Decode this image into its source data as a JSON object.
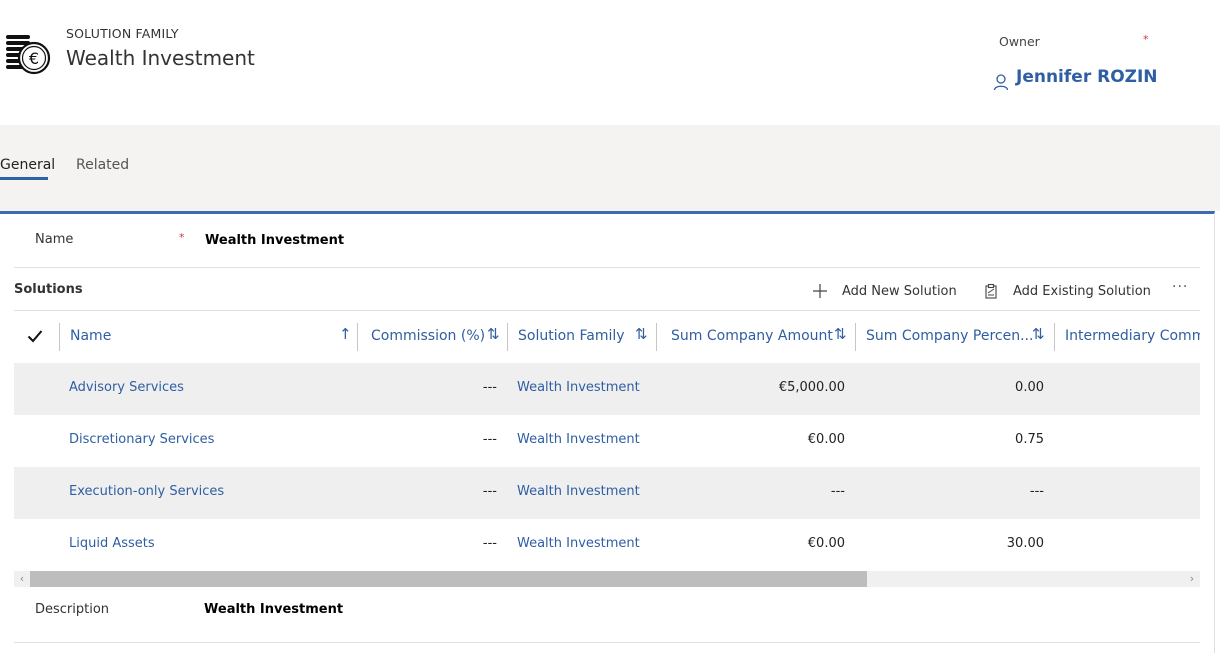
{
  "header": {
    "entity_type": "SOLUTION FAMILY",
    "record_title": "Wealth Investment",
    "entity_icon": "coins-euro-icon",
    "owner_label": "Owner",
    "owner_required": "*",
    "owner_name": "Jennifer ROZIN",
    "owner_icon": "user-icon"
  },
  "tabs": [
    {
      "label": "General",
      "active": true
    },
    {
      "label": "Related",
      "active": false
    }
  ],
  "form": {
    "name_label": "Name",
    "name_required": "*",
    "name_value": "Wealth Investment",
    "description_label": "Description",
    "description_value": "Wealth Investment"
  },
  "subgrid": {
    "title": "Solutions",
    "commands": {
      "add_new": "Add New Solution",
      "add_existing": "Add Existing Solution",
      "more": "···"
    },
    "select_all_icon": "checkmark-icon",
    "columns": [
      {
        "label": "Name",
        "sort": "↑"
      },
      {
        "label": "Commission (%)",
        "sort": "⇅"
      },
      {
        "label": "Solution Family",
        "sort": "⇅"
      },
      {
        "label": "Sum Company Amount",
        "sort": "⇅"
      },
      {
        "label": "Sum Company Percen...",
        "sort": "⇅"
      },
      {
        "label": "Intermediary Commi"
      }
    ],
    "rows": [
      {
        "name": "Advisory Services",
        "commission": "---",
        "family": "Wealth Investment",
        "amount": "€5,000.00",
        "percent": "0.00"
      },
      {
        "name": "Discretionary Services",
        "commission": "---",
        "family": "Wealth Investment",
        "amount": "€0.00",
        "percent": "0.75"
      },
      {
        "name": "Execution-only Services",
        "commission": "---",
        "family": "Wealth Investment",
        "amount": "---",
        "percent": "---"
      },
      {
        "name": "Liquid Assets",
        "commission": "---",
        "family": "Wealth Investment",
        "amount": "€0.00",
        "percent": "30.00"
      }
    ],
    "scrollbar": {
      "left_arrow": "‹",
      "right_arrow": "›",
      "thumb_fraction": 0.71
    }
  },
  "colors": {
    "accent": "#2f5ea3",
    "tab_band": "#f4f3f2",
    "row_alt": "#efefef",
    "required": "#d13438"
  }
}
